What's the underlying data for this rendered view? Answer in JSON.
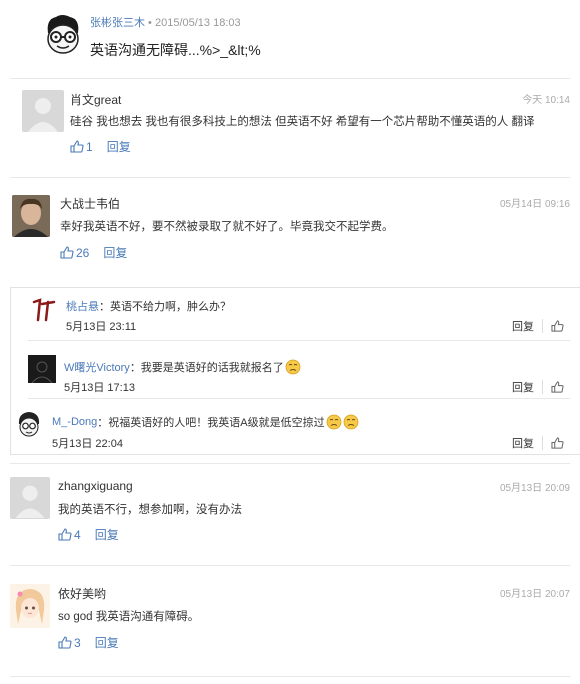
{
  "post": {
    "author": "张彬张三木",
    "separator": " • ",
    "timestamp": "2015/05/13 18:03",
    "text": "英语沟通无障碍...%>_&lt;%"
  },
  "comments": [
    {
      "name": "肖文great",
      "time": "今天 10:14",
      "text": "硅谷 我也想去 我也有很多科技上的想法 但英语不好 希望有一个芯片帮助不懂英语的人 翻译",
      "likes": "1",
      "reply": "回复"
    },
    {
      "name": "大战士韦伯",
      "time": "05月14日 09:16",
      "text": "幸好我英语不好，要不然被录取了就不好了。毕竟我交不起学费。",
      "likes": "26",
      "reply": "回复"
    },
    {
      "name": "zhangxiguang",
      "time": "05月13日 20:09",
      "text": "我的英语不行，想参加啊，没有办法",
      "likes": "4",
      "reply": "回复"
    },
    {
      "name": "依好美哟",
      "time": "05月13日 20:07",
      "text": "so god 我英语沟通有障碍。",
      "likes": "3",
      "reply": "回复"
    }
  ],
  "subcomments": [
    {
      "name": "桃占悬",
      "text": "：英语不给力啊，肿么办？",
      "time": "5月13日 23:11",
      "reply": "回复"
    },
    {
      "name": "W曙光Victory",
      "text": "：我要是英语好的话我就报名了",
      "time": "5月13日 17:13",
      "reply": "回复"
    },
    {
      "name": "M_-Dong",
      "text": "：祝福英语好的人吧！我英语A级就是低空掠过",
      "time": "5月13日 22:04",
      "reply": "回复"
    }
  ],
  "icons": {
    "like": "thumbs-up-icon",
    "emoji": "sad-face-icon"
  },
  "colors": {
    "link_blue": "#4a7ab8",
    "meta_gray": "#999999"
  }
}
